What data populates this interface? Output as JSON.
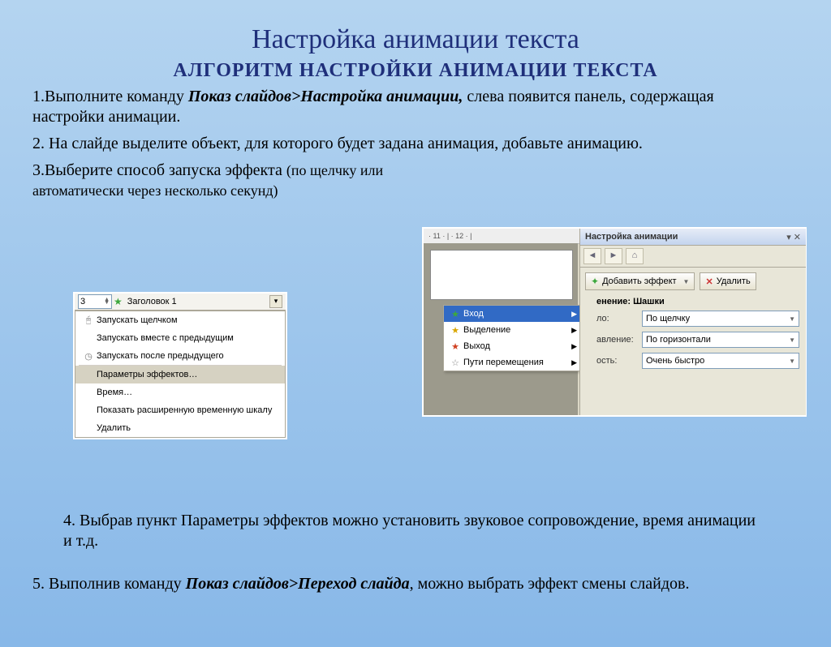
{
  "title": "Настройка анимации текста",
  "subtitle": "АЛГОРИТМ НАСТРОЙКИ АНИМАЦИИ ТЕКСТА",
  "step1_pre": "1.Выполните команду ",
  "step1_bi": "Показ слайдов>Настройка анимации,",
  "step1_post": " слева появится панель, содержащая настройки анимации.",
  "step2": "2. На слайде выделите объект, для которого будет задана анимация, добавьте анимацию.",
  "step3_pre": "3.Выберите способ запуска эффекта ",
  "step3_paren": "(по щелчку или автоматически через несколько секунд)",
  "step4": "4. Выбрав пункт Параметры эффектов можно установить звуковое сопровождение, время анимации и т.д.",
  "step5_pre": "5. Выполнив команду ",
  "step5_bi": "Показ слайдов>Переход слайда",
  "step5_post": ", можно выбрать эффект смены слайдов.",
  "leftMenu": {
    "numValue": "3",
    "header": "Заголовок 1",
    "items": [
      "Запускать щелчком",
      "Запускать вместе с предыдущим",
      "Запускать после предыдущего",
      "Параметры эффектов…",
      "Время…",
      "Показать расширенную временную шкалу",
      "Удалить"
    ]
  },
  "rightPanel": {
    "rulerText": "· 11 · | · 12 · |",
    "paneTitle": "Настройка анимации",
    "addEffect": "Добавить эффект",
    "delete": "Удалить",
    "section": "енение: Шашки",
    "rows": [
      {
        "label": "ло:",
        "value": "По щелчку"
      },
      {
        "label": "авление:",
        "value": "По горизонтали"
      },
      {
        "label": "ость:",
        "value": "Очень быстро"
      }
    ],
    "submenu": [
      "Вход",
      "Выделение",
      "Выход",
      "Пути перемещения"
    ]
  }
}
